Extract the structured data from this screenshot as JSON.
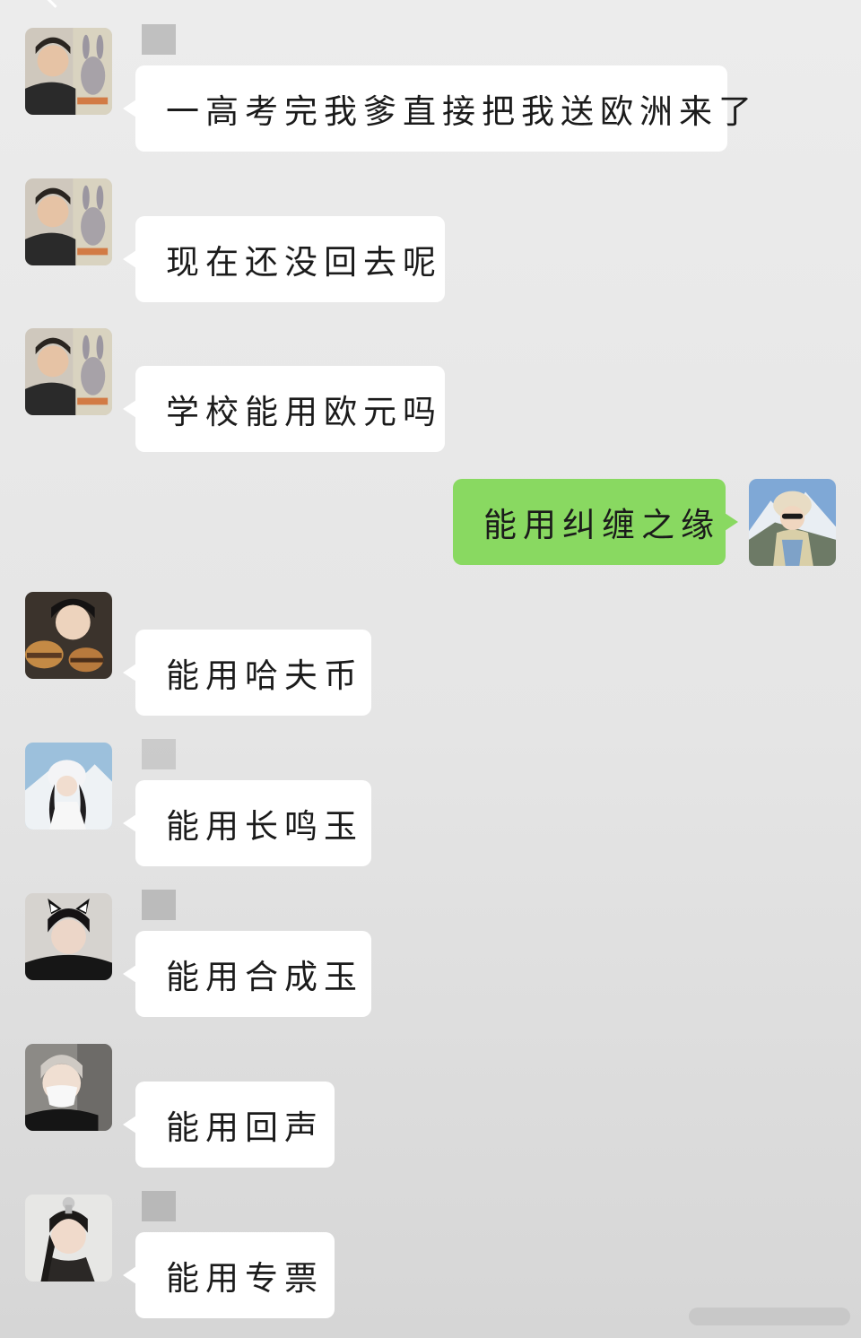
{
  "chat": {
    "messages": [
      {
        "side": "left",
        "avatar": "avatar-boy-with-plush-toy",
        "text": "一高考完我爹直接把我送欧洲来了",
        "show_name": true
      },
      {
        "side": "left",
        "avatar": "avatar-boy-with-plush-toy",
        "text": "现在还没回去呢",
        "show_name": false
      },
      {
        "side": "left",
        "avatar": "avatar-boy-with-plush-toy",
        "text": "学校能用欧元吗",
        "show_name": false
      },
      {
        "side": "right",
        "avatar": "avatar-girl-in-mountains",
        "text": "能用纠缠之缘"
      },
      {
        "side": "left",
        "avatar": "avatar-boy-with-burger",
        "text": "能用哈夫币",
        "show_name": false
      },
      {
        "side": "left",
        "avatar": "avatar-girl-in-snow",
        "text": "能用长鸣玉",
        "show_name": true
      },
      {
        "side": "left",
        "avatar": "avatar-boy-cat-ears",
        "text": "能用合成玉",
        "show_name": true
      },
      {
        "side": "left",
        "avatar": "avatar-boy-face-mask",
        "text": "能用回声",
        "show_name": false
      },
      {
        "side": "left",
        "avatar": "avatar-costume-man",
        "text": "能用专票",
        "show_name": true
      }
    ]
  },
  "colors": {
    "incoming_bubble": "#ffffff",
    "outgoing_bubble": "#89d961",
    "background": "#e9e9e9"
  }
}
